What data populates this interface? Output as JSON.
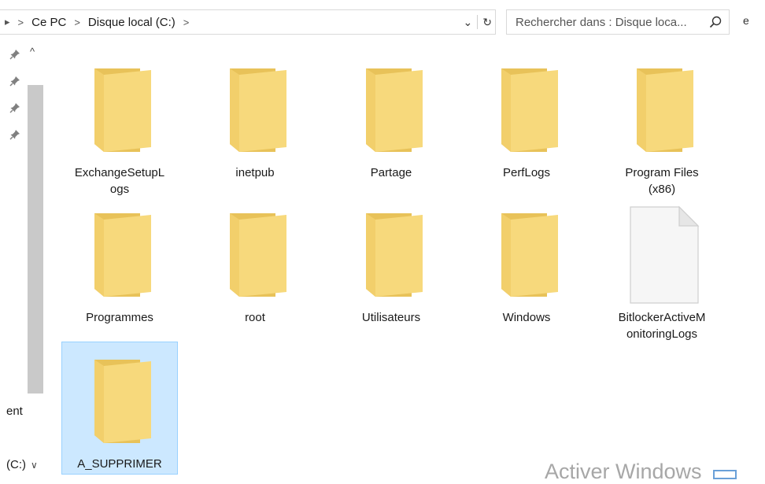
{
  "window": {
    "breadcrumb": {
      "clipped_arrow": "▸",
      "separator": ">",
      "items": [
        "Ce PC",
        "Disque local (C:)"
      ],
      "trailing": ">"
    },
    "dropdown_glyph": "⌄",
    "refresh_glyph": "↻",
    "search": {
      "placeholder": "Rechercher dans : Disque loca..."
    },
    "edge_letter": "e"
  },
  "nav": {
    "pin_glyph": "📌",
    "scroll_up_glyph": "^",
    "items": [
      {
        "text": "ent"
      },
      {
        "text": "(C:)",
        "chevron": "∨"
      }
    ]
  },
  "files": [
    {
      "name": "ExchangeSetupLogs",
      "type": "folder",
      "display": "ExchangeSetupL\nogs"
    },
    {
      "name": "inetpub",
      "type": "folder",
      "display": "inetpub"
    },
    {
      "name": "Partage",
      "type": "folder",
      "display": "Partage"
    },
    {
      "name": "PerfLogs",
      "type": "folder",
      "display": "PerfLogs"
    },
    {
      "name": "Program Files (x86)",
      "type": "folder",
      "display": "Program Files\n(x86)"
    },
    {
      "name": "Programmes",
      "type": "folder",
      "display": "Programmes"
    },
    {
      "name": "root",
      "type": "folder",
      "display": "root"
    },
    {
      "name": "Utilisateurs",
      "type": "folder",
      "display": "Utilisateurs"
    },
    {
      "name": "Windows",
      "type": "folder",
      "display": "Windows"
    },
    {
      "name": "BitlockerActiveMonitoringLogs",
      "type": "file",
      "display": "BitlockerActiveM\nonitoringLogs"
    },
    {
      "name": "A_SUPPRIMER",
      "type": "folder",
      "display": "A_SUPPRIMER",
      "selected": true
    }
  ],
  "watermark": "Activer Windows",
  "colors": {
    "folder_back": "#e8c259",
    "folder_front": "#f7d97c",
    "selection_fill": "#cce8ff",
    "selection_border": "#99d1ff"
  }
}
